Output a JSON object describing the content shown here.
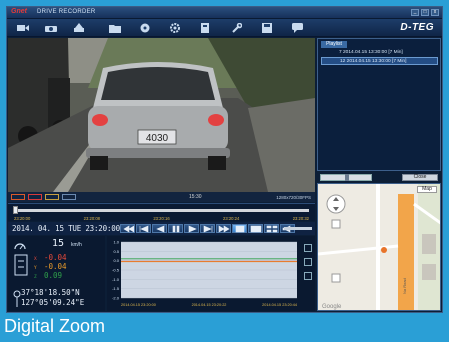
{
  "app": {
    "logo": "Gnet",
    "title": "DRIVE RECORDER",
    "brand": "D-TEG",
    "window_buttons": [
      "_",
      "□",
      "x"
    ]
  },
  "toolbar": {
    "icons": [
      "video-camera-icon",
      "camera-icon",
      "upload-icon",
      "folder-icon",
      "disc-icon",
      "settings-cog-icon",
      "storage-icon",
      "wrench-icon",
      "save-icon",
      "chat-icon"
    ]
  },
  "video": {
    "plate": "4030",
    "timestamp": "15:30",
    "resolution": "1280x720/30FPS"
  },
  "playlist": {
    "tab": "Playlist",
    "items": [
      "7  2014.04.15 13:30:00 [7 Min]",
      "12  2014.04.15 13:30:00 [7 Min]"
    ],
    "selected_index": 1,
    "close_label": "Close"
  },
  "map": {
    "type_button": "Map",
    "road_label": "Na Road",
    "watermark": "Google"
  },
  "timeline": {
    "labels": [
      "23:20:00",
      "23:20:08",
      "23:20:16",
      "23:20:24",
      "23:20:32"
    ],
    "position": 0.01
  },
  "controls": {
    "datetime": "2014. 04. 15 TUE 23:20:00",
    "buttons": [
      "rewind-icon",
      "step-back-icon",
      "prev-icon",
      "pause-icon",
      "next-icon",
      "step-forward-icon",
      "fast-forward-icon",
      "zoom-icon",
      "fullscreen-icon",
      "grid-icon",
      "speaker-icon"
    ],
    "active_button": 7
  },
  "gauges": {
    "speed": "15",
    "speed_unit": "km/h",
    "x_label": "X",
    "y_label": "Y",
    "z_label": "Z",
    "x_value": "-0.04",
    "y_value": "-0.04",
    "z_value": "0.09",
    "lat": "37°18'18.50\"N",
    "lon": "127°05'09.24\"E"
  },
  "chart_data": {
    "type": "line",
    "x": [
      "2014.04.15 23:20:00",
      "2014.04.15 23:20:22",
      "2014.04.15 23:20:44"
    ],
    "y_ticks": [
      "1.0",
      "0.5",
      "0.0",
      "-0.5",
      "-1.0",
      "-1.5",
      "-2.0"
    ],
    "ylim": [
      -2.0,
      1.0
    ],
    "series": [
      {
        "values": [
          0.1,
          0.1,
          0.1
        ],
        "color": "#2fa04a"
      },
      {
        "values": [
          -0.03,
          -0.03,
          -0.03
        ],
        "color": "#e84a3a"
      },
      {
        "values": [
          -0.06,
          -0.06,
          -0.06
        ],
        "color": "#e89a2a"
      }
    ]
  },
  "caption": "Digital Zoom",
  "colors": {
    "accent": "#2a9fd6",
    "panel": "#0c1e36",
    "active": "#3a84cf"
  }
}
